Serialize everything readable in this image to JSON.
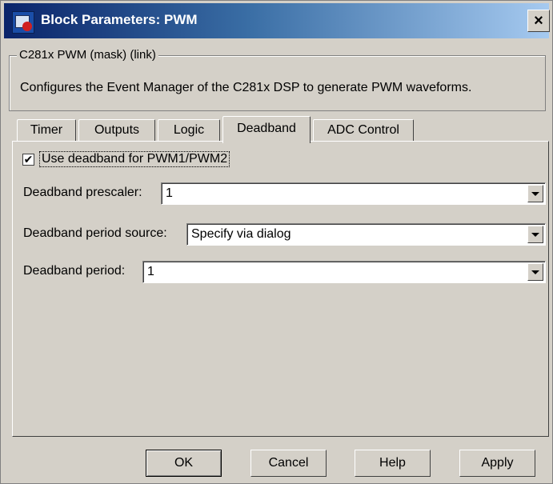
{
  "window": {
    "title": "Block Parameters: PWM",
    "close_label": "×"
  },
  "group": {
    "legend": "C281x PWM (mask) (link)",
    "description": "Configures the Event Manager of the C281x DSP to generate PWM waveforms."
  },
  "tabs": [
    {
      "label": "Timer",
      "active": false
    },
    {
      "label": "Outputs",
      "active": false
    },
    {
      "label": "Logic",
      "active": false
    },
    {
      "label": "Deadband",
      "active": true
    },
    {
      "label": "ADC Control",
      "active": false
    }
  ],
  "deadband": {
    "use_checkbox": {
      "label": "Use deadband for PWM1/PWM2",
      "checked": true,
      "mark": "✔"
    },
    "prescaler": {
      "label": "Deadband prescaler:",
      "value": "1"
    },
    "period_source": {
      "label": "Deadband period source:",
      "value": "Specify via dialog"
    },
    "period": {
      "label": "Deadband period:",
      "value": "1"
    }
  },
  "buttons": {
    "ok": "OK",
    "cancel": "Cancel",
    "help": "Help",
    "apply": "Apply"
  },
  "colors": {
    "dialog_bg": "#d4d0c8",
    "title_start": "#0a246a",
    "title_end": "#a6caf0"
  },
  "icons": {
    "app": "simulink-block-icon",
    "close": "close-icon",
    "dropdown": "chevron-down-icon",
    "check": "checkmark-icon"
  }
}
